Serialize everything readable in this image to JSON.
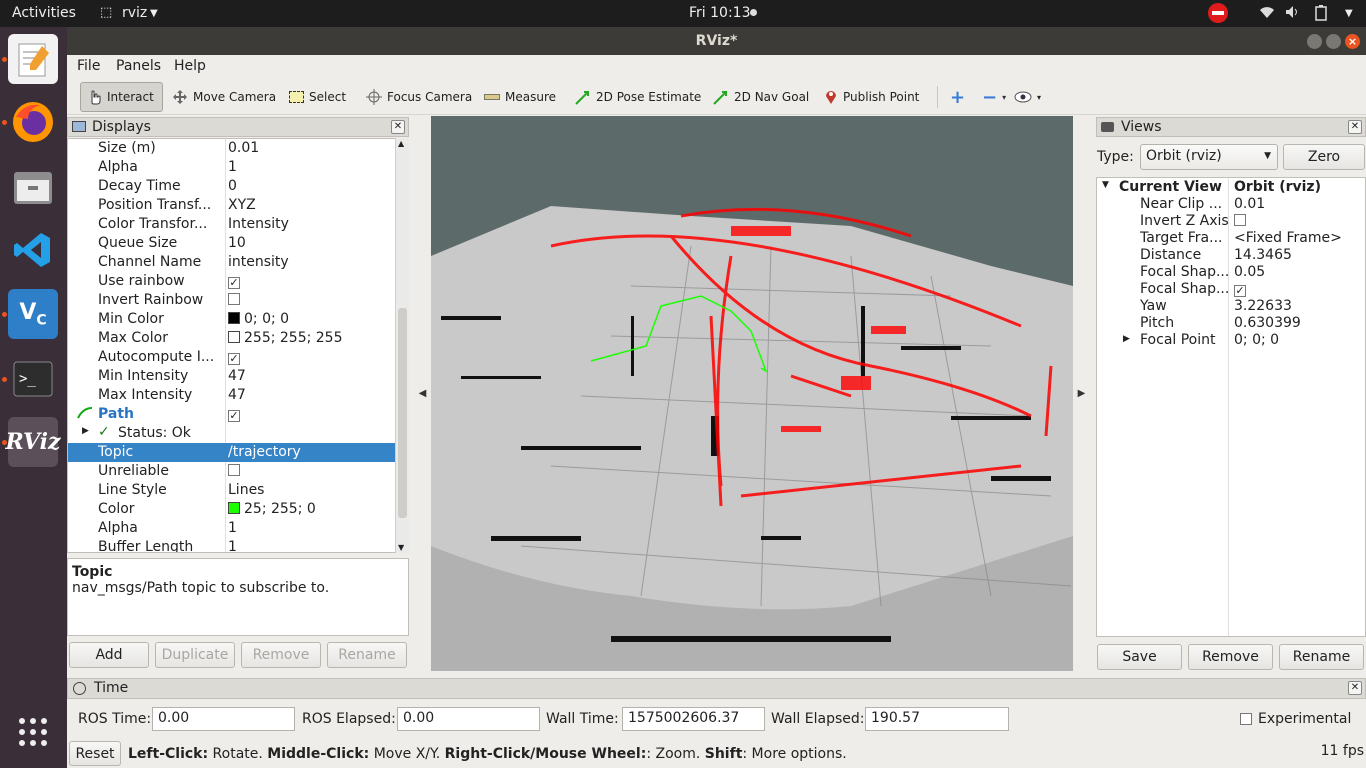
{
  "topbar": {
    "activities": "Activities",
    "app_name": "rviz",
    "clock": "Fri 10:13"
  },
  "window": {
    "title": "RViz*"
  },
  "menu": [
    "File",
    "Panels",
    "Help"
  ],
  "toolbar": {
    "interact": "Interact",
    "move_camera": "Move Camera",
    "select": "Select",
    "focus_camera": "Focus Camera",
    "measure": "Measure",
    "pose_estimate": "2D Pose Estimate",
    "nav_goal": "2D Nav Goal",
    "publish_point": "Publish Point"
  },
  "displays": {
    "title": "Displays",
    "rows": [
      {
        "key": "Size (m)",
        "value": "0.01"
      },
      {
        "key": "Alpha",
        "value": "1"
      },
      {
        "key": "Decay Time",
        "value": "0"
      },
      {
        "key": "Position Transf...",
        "value": "XYZ"
      },
      {
        "key": "Color Transfor...",
        "value": "Intensity"
      },
      {
        "key": "Queue Size",
        "value": "10"
      },
      {
        "key": "Channel Name",
        "value": "intensity"
      },
      {
        "key": "Use rainbow",
        "value": ""
      },
      {
        "key": "Invert Rainbow",
        "value": ""
      },
      {
        "key": "Min Color",
        "value": "0; 0; 0"
      },
      {
        "key": "Max Color",
        "value": "255; 255; 255"
      },
      {
        "key": "Autocompute I...",
        "value": ""
      },
      {
        "key": "Min Intensity",
        "value": "47"
      },
      {
        "key": "Max Intensity",
        "value": "47"
      },
      {
        "key": "Path",
        "value": ""
      },
      {
        "key": "Status: Ok",
        "value": ""
      },
      {
        "key": "Topic",
        "value": "/trajectory"
      },
      {
        "key": "Unreliable",
        "value": ""
      },
      {
        "key": "Line Style",
        "value": "Lines"
      },
      {
        "key": "Color",
        "value": "25; 255; 0"
      },
      {
        "key": "Alpha",
        "value": "1"
      },
      {
        "key": "Buffer Length",
        "value": "1"
      }
    ],
    "desc_title": "Topic",
    "desc_text": "nav_msgs/Path topic to subscribe to.",
    "buttons": {
      "add": "Add",
      "duplicate": "Duplicate",
      "remove": "Remove",
      "rename": "Rename"
    }
  },
  "views": {
    "title": "Views",
    "type_label": "Type:",
    "type_value": "Orbit (rviz)",
    "zero": "Zero",
    "current_view": "Current View",
    "current_view_value": "Orbit (rviz)",
    "rows": [
      {
        "key": "Near Clip ...",
        "value": "0.01"
      },
      {
        "key": "Invert Z Axis",
        "value": ""
      },
      {
        "key": "Target Fra...",
        "value": "<Fixed Frame>"
      },
      {
        "key": "Distance",
        "value": "14.3465"
      },
      {
        "key": "Focal Shap...",
        "value": "0.05"
      },
      {
        "key": "Focal Shap...",
        "value": ""
      },
      {
        "key": "Yaw",
        "value": "3.22633"
      },
      {
        "key": "Pitch",
        "value": "0.630399"
      },
      {
        "key": "Focal Point",
        "value": "0; 0; 0"
      }
    ],
    "buttons": {
      "save": "Save",
      "remove": "Remove",
      "rename": "Rename"
    }
  },
  "time": {
    "title": "Time",
    "ros_time_label": "ROS Time:",
    "ros_time": "0.00",
    "ros_elapsed_label": "ROS Elapsed:",
    "ros_elapsed": "0.00",
    "wall_time_label": "Wall Time:",
    "wall_time": "1575002606.37",
    "wall_elapsed_label": "Wall Elapsed:",
    "wall_elapsed": "190.57",
    "experimental": "Experimental"
  },
  "status": {
    "reset": "Reset",
    "help_b1": "Left-Click:",
    "help_t1": " Rotate. ",
    "help_b2": "Middle-Click:",
    "help_t2": " Move X/Y. ",
    "help_b3": "Right-Click/Mouse Wheel:",
    "help_t3": ": Zoom. ",
    "help_b4": "Shift",
    "help_t4": ": More options.",
    "fps": "11 fps"
  },
  "colors": {
    "selection": "#3584c8",
    "path_green": "#19ff00",
    "cloud_red": "#ff0000",
    "viewport_bg": "#5c6b69"
  }
}
